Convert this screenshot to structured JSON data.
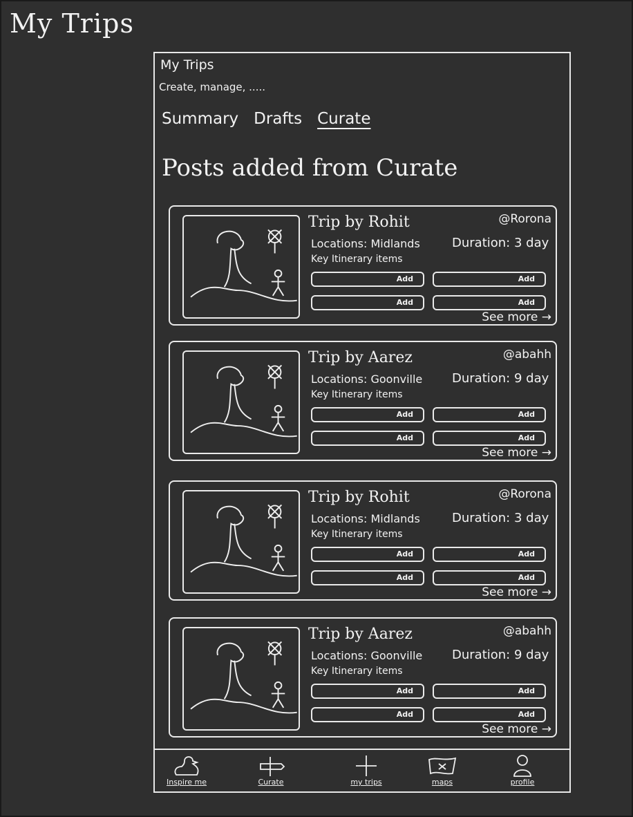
{
  "board_title": "My Trips",
  "header": {
    "title": "My Trips",
    "subtitle": "Create, manage, ....."
  },
  "tabs": [
    {
      "label": "Summary"
    },
    {
      "label": "Drafts"
    },
    {
      "label": "Curate",
      "active": true
    }
  ],
  "section_title": "Posts added from Curate",
  "add_label": "Add",
  "see_more_label": "See more →",
  "itinerary_label": "Key Itinerary items",
  "cards": [
    {
      "title": "Trip by Rohit",
      "handle": "@Rorona",
      "locations": "Locations: Midlands",
      "duration": "Duration: 3 day"
    },
    {
      "title": "Trip by Aarez",
      "handle": "@abahh",
      "locations": "Locations: Goonville",
      "duration": "Duration: 9 day"
    },
    {
      "title": "Trip by Rohit",
      "handle": "@Rorona",
      "locations": "Locations: Midlands",
      "duration": "Duration: 3 day"
    },
    {
      "title": "Trip by Aarez",
      "handle": "@abahh",
      "locations": "Locations: Goonville",
      "duration": "Duration: 9 day"
    }
  ],
  "nav": [
    {
      "label": "Inspire me",
      "icon": "duck-icon"
    },
    {
      "label": "Curate",
      "icon": "pen-icon"
    },
    {
      "label": "my trips",
      "icon": "plus-icon"
    },
    {
      "label": "maps",
      "icon": "map-icon"
    },
    {
      "label": "profile",
      "icon": "user-icon"
    }
  ]
}
